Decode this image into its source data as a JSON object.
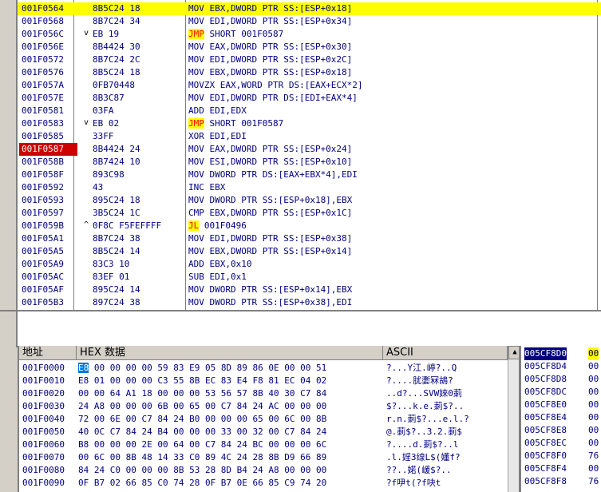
{
  "disasm": {
    "rows": [
      {
        "addr": "001F0564",
        "hex": "8B5C24 18",
        "mark": "",
        "asm": "MOV EBX,DWORD PTR SS:[ESP+0x18]",
        "kw": "",
        "kwrest": "",
        "state": "selected"
      },
      {
        "addr": "001F0568",
        "hex": "8B7C24 34",
        "mark": "",
        "asm": "MOV EDI,DWORD PTR SS:[ESP+0x34]",
        "kw": "",
        "kwrest": "",
        "state": ""
      },
      {
        "addr": "001F056C",
        "hex": "EB 19",
        "mark": "v",
        "asm": "",
        "kw": "JMP",
        "kwrest": " SHORT 001F0587",
        "state": ""
      },
      {
        "addr": "001F056E",
        "hex": "8B4424 30",
        "mark": "",
        "asm": "MOV EAX,DWORD PTR SS:[ESP+0x30]",
        "kw": "",
        "kwrest": "",
        "state": ""
      },
      {
        "addr": "001F0572",
        "hex": "8B7C24 2C",
        "mark": "",
        "asm": "MOV EDI,DWORD PTR SS:[ESP+0x2C]",
        "kw": "",
        "kwrest": "",
        "state": ""
      },
      {
        "addr": "001F0576",
        "hex": "8B5C24 18",
        "mark": "",
        "asm": "MOV EBX,DWORD PTR SS:[ESP+0x18]",
        "kw": "",
        "kwrest": "",
        "state": ""
      },
      {
        "addr": "001F057A",
        "hex": "0FB70448",
        "mark": "",
        "asm": "MOVZX EAX,WORD PTR DS:[EAX+ECX*2]",
        "kw": "",
        "kwrest": "",
        "state": ""
      },
      {
        "addr": "001F057E",
        "hex": "8B3C87",
        "mark": "",
        "asm": "MOV EDI,DWORD PTR DS:[EDI+EAX*4]",
        "kw": "",
        "kwrest": "",
        "state": ""
      },
      {
        "addr": "001F0581",
        "hex": "03FA",
        "mark": "",
        "asm": "ADD EDI,EDX",
        "kw": "",
        "kwrest": "",
        "state": ""
      },
      {
        "addr": "001F0583",
        "hex": "EB 02",
        "mark": "v",
        "asm": "",
        "kw": "JMP",
        "kwrest": " SHORT 001F0587",
        "state": ""
      },
      {
        "addr": "001F0585",
        "hex": "33FF",
        "mark": "",
        "asm": "XOR EDI,EDI",
        "kw": "",
        "kwrest": "",
        "state": ""
      },
      {
        "addr": "001F0587",
        "hex": "8B4424 24",
        "mark": "",
        "asm": "MOV EAX,DWORD PTR SS:[ESP+0x24]",
        "kw": "",
        "kwrest": "",
        "state": "breakpoint"
      },
      {
        "addr": "001F058B",
        "hex": "8B7424 10",
        "mark": "",
        "asm": "MOV ESI,DWORD PTR SS:[ESP+0x10]",
        "kw": "",
        "kwrest": "",
        "state": ""
      },
      {
        "addr": "001F058F",
        "hex": "893C98",
        "mark": "",
        "asm": "MOV DWORD PTR DS:[EAX+EBX*4],EDI",
        "kw": "",
        "kwrest": "",
        "state": ""
      },
      {
        "addr": "001F0592",
        "hex": "43",
        "mark": "",
        "asm": "INC EBX",
        "kw": "",
        "kwrest": "",
        "state": ""
      },
      {
        "addr": "001F0593",
        "hex": "895C24 18",
        "mark": "",
        "asm": "MOV DWORD PTR SS:[ESP+0x18],EBX",
        "kw": "",
        "kwrest": "",
        "state": ""
      },
      {
        "addr": "001F0597",
        "hex": "3B5C24 1C",
        "mark": "",
        "asm": "CMP EBX,DWORD PTR SS:[ESP+0x1C]",
        "kw": "",
        "kwrest": "",
        "state": ""
      },
      {
        "addr": "001F059B",
        "hex": "0F8C F5FEFFFF",
        "mark": "^",
        "asm": "",
        "kw": "JL",
        "kwrest": " 001F0496",
        "state": ""
      },
      {
        "addr": "001F05A1",
        "hex": "8B7C24 38",
        "mark": "",
        "asm": "MOV EDI,DWORD PTR SS:[ESP+0x38]",
        "kw": "",
        "kwrest": "",
        "state": ""
      },
      {
        "addr": "001F05A5",
        "hex": "8B5C24 14",
        "mark": "",
        "asm": "MOV EBX,DWORD PTR SS:[ESP+0x14]",
        "kw": "",
        "kwrest": "",
        "state": ""
      },
      {
        "addr": "001F05A9",
        "hex": "83C3 10",
        "mark": "",
        "asm": "ADD EBX,0x10",
        "kw": "",
        "kwrest": "",
        "state": ""
      },
      {
        "addr": "001F05AC",
        "hex": "83EF 01",
        "mark": "",
        "asm": "SUB EDI,0x1",
        "kw": "",
        "kwrest": "",
        "state": ""
      },
      {
        "addr": "001F05AF",
        "hex": "895C24 14",
        "mark": "",
        "asm": "MOV DWORD PTR SS:[ESP+0x14],EBX",
        "kw": "",
        "kwrest": "",
        "state": ""
      },
      {
        "addr": "001F05B3",
        "hex": "897C24 38",
        "mark": "",
        "asm": "MOV DWORD PTR SS:[ESP+0x38],EDI",
        "kw": "",
        "kwrest": "",
        "state": ""
      }
    ]
  },
  "dump": {
    "headers": {
      "address": "地址",
      "hex": "HEX 数据",
      "ascii": "ASCII"
    },
    "rows": [
      {
        "addr": "001F0000",
        "hexFirst": "E8",
        "hexRest": " 00 00 00 00 59 83 E9 05 8D 89 86 0E 00 00 51",
        "ascii": "?...Y江.嵉?..Q"
      },
      {
        "addr": "001F0010",
        "hexFirst": "",
        "hexRest": "E8 01 00 00 00 C3 55 8B EC 83 E4 F8 81 EC 04 02",
        "ascii": "?....肬嬱冧鴣?"
      },
      {
        "addr": "001F0020",
        "hexFirst": "",
        "hexRest": "00 00 64 A1 18 00 00 00 53 56 57 8B 40 30 C7 84",
        "ascii": "..d?...SVW婡0莿"
      },
      {
        "addr": "001F0030",
        "hexFirst": "",
        "hexRest": "24 A8 00 00 00 6B 00 65 00 C7 84 24 AC 00 00 00",
        "ascii": "$?...k.e.莿$?.."
      },
      {
        "addr": "001F0040",
        "hexFirst": "",
        "hexRest": "72 00 6E 00 C7 84 24 B0 00 00 00 65 00 6C 00 8B",
        "ascii": "r.n.莿$?...e.l.?"
      },
      {
        "addr": "001F0050",
        "hexFirst": "",
        "hexRest": "40 0C C7 84 24 B4 00 00 00 33 00 32 00 C7 84 24",
        "ascii": "@.莿$?..3.2.莿$"
      },
      {
        "addr": "001F0060",
        "hexFirst": "",
        "hexRest": "B8 00 00 00 2E 00 64 00 C7 84 24 BC 00 00 00 6C",
        "ascii": "?....d.莿$?..l"
      },
      {
        "addr": "001F0070",
        "hexFirst": "",
        "hexRest": "00 6C 00 8B 48 14 33 C0 89 4C 24 28 8B D9 66 89",
        "ascii": ".l.婬3缐L$(嬞f?"
      },
      {
        "addr": "001F0080",
        "hexFirst": "",
        "hexRest": "84 24 C0 00 00 00 8B 53 28 8D B4 24 A8 00 00 00",
        "ascii": "??..婼(嵈$?.."
      },
      {
        "addr": "001F0090",
        "hexFirst": "",
        "hexRest": "0F B7 02 66 85 C0 74 28 0F B7 0E 66 85 C9 74 20",
        "ascii": "?f吚t(?f吷t"
      }
    ]
  },
  "stack": {
    "rows": [
      {
        "addr": "005CF8D0",
        "val": "00",
        "state": "selected"
      },
      {
        "addr": "005CF8D4",
        "val": "00",
        "state": ""
      },
      {
        "addr": "005CF8D8",
        "val": "00",
        "state": ""
      },
      {
        "addr": "005CF8DC",
        "val": "00",
        "state": ""
      },
      {
        "addr": "005CF8E0",
        "val": "00",
        "state": ""
      },
      {
        "addr": "005CF8E4",
        "val": "00",
        "state": ""
      },
      {
        "addr": "005CF8E8",
        "val": "00",
        "state": ""
      },
      {
        "addr": "005CF8EC",
        "val": "00",
        "state": ""
      },
      {
        "addr": "005CF8F0",
        "val": "76",
        "state": ""
      },
      {
        "addr": "005CF8F4",
        "val": "00",
        "state": ""
      },
      {
        "addr": "005CF8F8",
        "val": "76",
        "state": ""
      }
    ]
  },
  "colors": {
    "selection": "#ffff00",
    "breakpoint": "#cc0000",
    "jumpKeyword": "#ff0000",
    "addressText": "#000080"
  }
}
